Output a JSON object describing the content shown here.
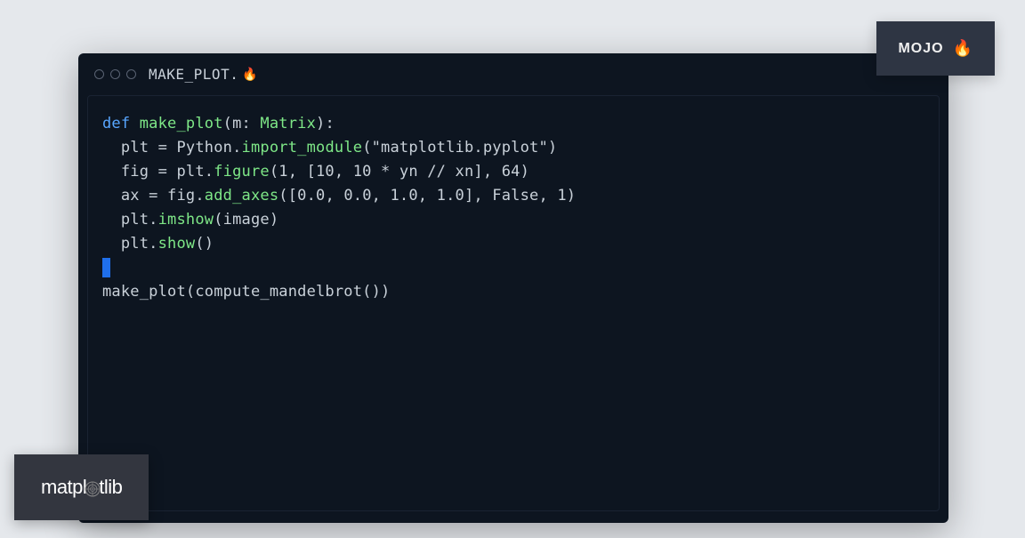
{
  "window": {
    "filename": "MAKE_PLOT.",
    "fire_icon": "🔥"
  },
  "code": {
    "line1": {
      "def": "def",
      "fn_name": " make_plot",
      "params_open": "(m: ",
      "type": "Matrix",
      "params_close": "):"
    },
    "line2": {
      "indent": "  plt = Python.",
      "method": "import_module",
      "args": "(\"matplotlib.pyplot\")"
    },
    "line3": {
      "indent": "  fig = plt.",
      "method": "figure",
      "args": "(1, [10, 10 * yn // xn], 64)"
    },
    "line4": {
      "indent": "  ax = fig.",
      "method": "add_axes",
      "args": "([0.0, 0.0, 1.0, 1.0], False, 1)"
    },
    "line5": {
      "indent": "  plt.",
      "method": "imshow",
      "args": "(image)"
    },
    "line6": {
      "indent": "  plt.",
      "method": "show",
      "args": "()"
    },
    "line8": "make_plot(compute_mandelbrot())"
  },
  "badges": {
    "mojo": "MOJO",
    "mojo_fire": "🔥",
    "matplotlib_pre": "matpl",
    "matplotlib_post": "tlib"
  }
}
